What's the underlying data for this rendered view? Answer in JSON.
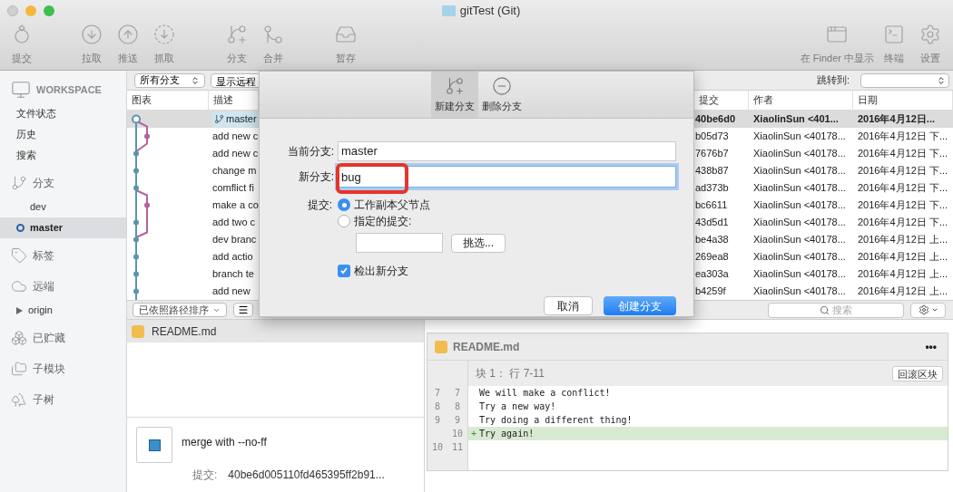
{
  "window": {
    "title": "gitTest (Git)"
  },
  "toolbar": {
    "left_groups": [
      {
        "items": [
          {
            "label": "提交"
          }
        ]
      },
      {
        "items": [
          {
            "label": "拉取"
          },
          {
            "label": "推送"
          },
          {
            "label": "抓取"
          }
        ]
      },
      {
        "items": [
          {
            "label": "分支"
          },
          {
            "label": "合并"
          }
        ]
      },
      {
        "items": [
          {
            "label": "暂存"
          }
        ]
      }
    ],
    "right_items": [
      {
        "label": "在 Finder 中显示"
      },
      {
        "label": "终端"
      },
      {
        "label": "设置"
      }
    ]
  },
  "sidebar": {
    "sections": [
      {
        "kind": "workspace",
        "title": "WORKSPACE",
        "items": [
          {
            "label": "文件状态",
            "selected": false
          },
          {
            "label": "历史",
            "selected": false
          },
          {
            "label": "搜索",
            "selected": false
          }
        ]
      },
      {
        "kind": "group",
        "title": "分支",
        "items": [
          {
            "label": "dev",
            "selected": false,
            "current": false
          },
          {
            "label": "master",
            "selected": true,
            "current": true
          }
        ]
      },
      {
        "kind": "group",
        "title": "标签"
      },
      {
        "kind": "group",
        "title": "远端",
        "items": [
          {
            "label": "origin",
            "selected": false,
            "expanded": false
          }
        ]
      },
      {
        "kind": "group",
        "title": "已贮藏"
      },
      {
        "kind": "group",
        "title": "子模块"
      },
      {
        "kind": "group",
        "title": "子树"
      }
    ]
  },
  "filter_bar": {
    "branch_select": "所有分支",
    "remote_button": "显示远程",
    "jump_label": "跳转到:"
  },
  "table": {
    "columns": [
      "图表",
      "描述",
      "提交",
      "作者",
      "日期"
    ],
    "rows": [
      {
        "kind": "branch",
        "description": "master",
        "commit": "40be6d0",
        "author": "XiaolinSun <401...",
        "date": "2016年4月12日...",
        "selected": true
      },
      {
        "kind": "message",
        "description": "add new c",
        "commit": "b05d73",
        "author": "XiaolinSun <40178...",
        "date": "2016年4月12日 下...",
        "selected": false
      },
      {
        "kind": "message",
        "description": "add new c",
        "commit": "7676b7",
        "author": "XiaolinSun <40178...",
        "date": "2016年4月12日 下...",
        "selected": false
      },
      {
        "kind": "message",
        "description": "change m",
        "commit": "438b87",
        "author": "XiaolinSun <40178...",
        "date": "2016年4月12日 下...",
        "selected": false
      },
      {
        "kind": "message",
        "description": "comflict fi",
        "commit": "ad373b",
        "author": "XiaolinSun <40178...",
        "date": "2016年4月12日 下...",
        "selected": false
      },
      {
        "kind": "message",
        "description": "make a co",
        "commit": "bc6611",
        "author": "XiaolinSun <40178...",
        "date": "2016年4月12日 下...",
        "selected": false
      },
      {
        "kind": "message",
        "description": "add two c",
        "commit": "43d5d1",
        "author": "XiaolinSun <40178...",
        "date": "2016年4月12日 下...",
        "selected": false
      },
      {
        "kind": "message",
        "description": "dev branc",
        "commit": "be4a38",
        "author": "XiaolinSun <40178...",
        "date": "2016年4月12日 上...",
        "selected": false
      },
      {
        "kind": "message",
        "description": "add  actio",
        "commit": "269ea8",
        "author": "XiaolinSun <40178...",
        "date": "2016年4月12日 上...",
        "selected": false
      },
      {
        "kind": "message",
        "description": "branch te",
        "commit": "ea303a",
        "author": "XiaolinSun <40178...",
        "date": "2016年4月12日 上...",
        "selected": false
      },
      {
        "kind": "message",
        "description": "add new",
        "commit": "b4259f",
        "author": "XiaolinSun <40178...",
        "date": "2016年4月12日 上...",
        "selected": false
      }
    ]
  },
  "bottom_bar": {
    "sort_select": "已依照路径排序",
    "search_placeholder": "搜索"
  },
  "files": [
    {
      "name": "README.md"
    }
  ],
  "commit_details": {
    "message": "merge with --no-ff",
    "commit_label": "提交:",
    "hash": "40be6d005110fd465395ff2b91..."
  },
  "diff": {
    "file": "README.md",
    "more": "•••",
    "hunk": "块 1： 行 7-11",
    "revert_button": "回滚区块",
    "lines": [
      {
        "kind": "context",
        "old": "7",
        "new": "7",
        "text": "We will make a conflict!"
      },
      {
        "kind": "context",
        "old": "8",
        "new": "8",
        "text": "Try a new way!"
      },
      {
        "kind": "context",
        "old": "9",
        "new": "9",
        "text": "Try doing a different thing!"
      },
      {
        "kind": "added",
        "new": "10",
        "marker": "+",
        "text": "Try again!"
      },
      {
        "kind": "context",
        "old": "10",
        "new": "11"
      }
    ]
  },
  "dialog": {
    "tabs": [
      {
        "label": "新建分支",
        "selected": true
      },
      {
        "label": "删除分支",
        "selected": false
      }
    ],
    "current_branch": {
      "label": "当前分支:",
      "value": "master"
    },
    "new_branch": {
      "label": "新分支:",
      "value": "bug",
      "focused": true,
      "highlighted": true
    },
    "commit": {
      "label": "提交:",
      "options": [
        {
          "label": "工作副本父节点",
          "selected": true
        },
        {
          "label": "指定的提交:",
          "selected": false
        }
      ],
      "pick_button": "挑选..."
    },
    "checkout": {
      "label": "检出新分支",
      "checked": true
    },
    "buttons": [
      {
        "label": "取消",
        "kind": "secondary"
      },
      {
        "label": "创建分支",
        "kind": "primary"
      }
    ]
  }
}
